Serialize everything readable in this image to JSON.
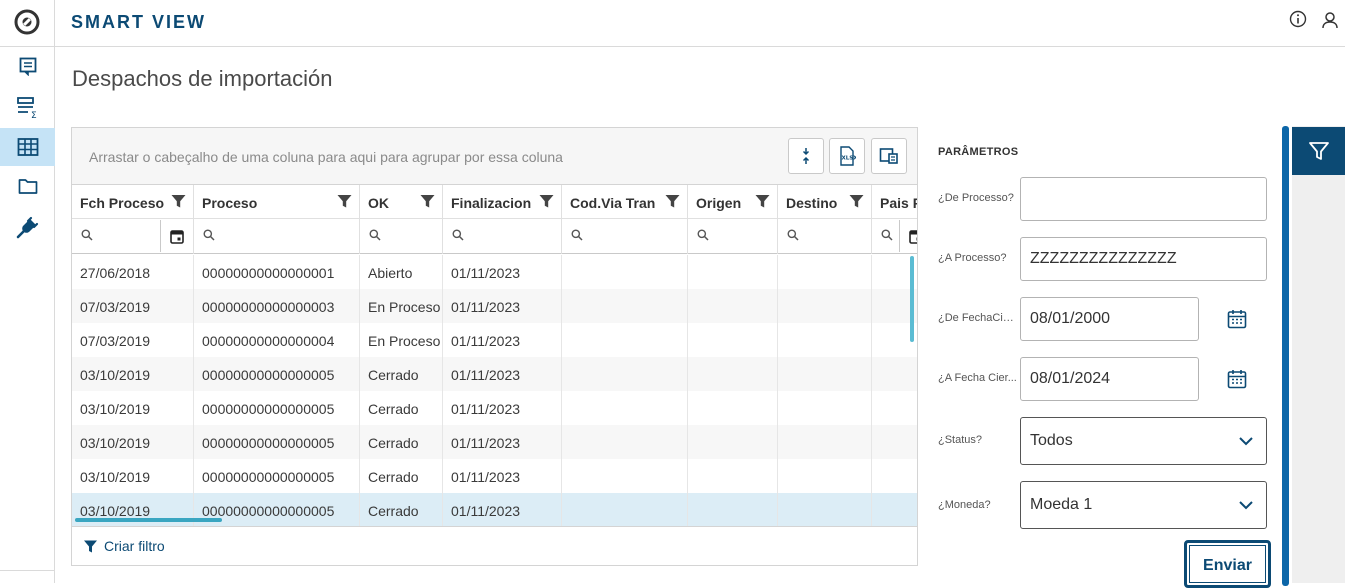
{
  "header": {
    "title": "SMART VIEW"
  },
  "page": {
    "title": "Despachos de importación"
  },
  "rail": {
    "items": [
      "report-icon",
      "summary-icon",
      "table-icon",
      "folder-icon",
      "plug-icon"
    ],
    "active": "table-icon"
  },
  "grid": {
    "group_hint": "Arrastar o cabeçalho de uma coluna para aqui para agrupar por essa coluna",
    "columns": [
      "Fch Proceso",
      "Proceso",
      "OK",
      "Finalizacion",
      "Cod.Via Tran",
      "Origen",
      "Destino",
      "Pais P"
    ],
    "rows": [
      [
        "27/06/2018",
        "00000000000000001",
        "Abierto",
        "01/11/2023"
      ],
      [
        "07/03/2019",
        "00000000000000003",
        "En Proceso",
        "01/11/2023"
      ],
      [
        "07/03/2019",
        "00000000000000004",
        "En Proceso",
        "01/11/2023"
      ],
      [
        "03/10/2019",
        "00000000000000005",
        "Cerrado",
        "01/11/2023"
      ],
      [
        "03/10/2019",
        "00000000000000005",
        "Cerrado",
        "01/11/2023"
      ],
      [
        "03/10/2019",
        "00000000000000005",
        "Cerrado",
        "01/11/2023"
      ],
      [
        "03/10/2019",
        "00000000000000005",
        "Cerrado",
        "01/11/2023"
      ],
      [
        "03/10/2019",
        "00000000000000005",
        "Cerrado",
        "01/11/2023"
      ]
    ],
    "selected_row": 7,
    "footer_link": "Criar filtro"
  },
  "params": {
    "title": "PARÂMETROS",
    "fields": [
      {
        "label": "¿De Processo?",
        "value": ""
      },
      {
        "label": "¿A Processo?",
        "value": "ZZZZZZZZZZZZZZZ"
      },
      {
        "label": "¿De FechaCie...",
        "value": "08/01/2000"
      },
      {
        "label": "¿A Fecha Cier...",
        "value": "08/01/2024"
      },
      {
        "label": "¿Status?",
        "value": "Todos"
      },
      {
        "label": "¿Moneda?",
        "value": "Moeda 1"
      }
    ],
    "submit_label": "Enviar"
  },
  "colors": {
    "brand": "#0c4a74",
    "accent": "#0c66a8",
    "selected_row": "#dcedf6",
    "rail_active": "#c5e3f6"
  }
}
